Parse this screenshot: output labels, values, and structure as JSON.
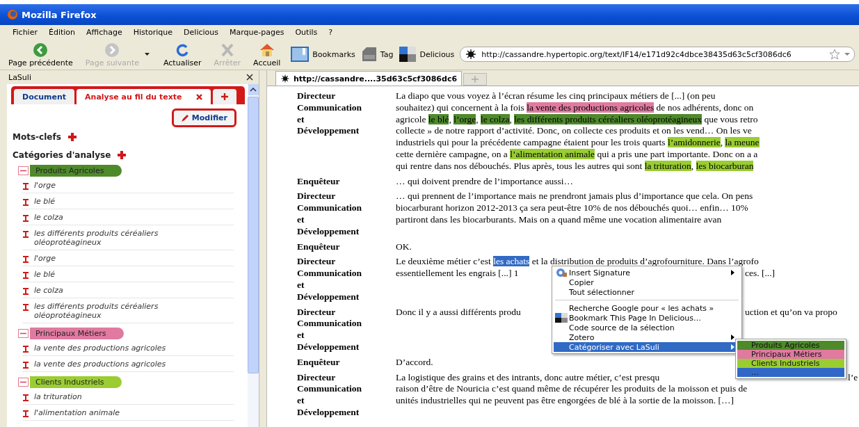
{
  "window": {
    "title": "Mozilla Firefox"
  },
  "menu": [
    "Fichier",
    "Édition",
    "Affichage",
    "Historique",
    "Delicious",
    "Marque-pages",
    "Outils",
    "?"
  ],
  "nav_buttons": [
    {
      "kind": "back",
      "label": "Page précédente",
      "disabled": false
    },
    {
      "kind": "forward",
      "label": "Page suivante",
      "disabled": true
    },
    {
      "kind": "reload",
      "label": "Actualiser",
      "disabled": false
    },
    {
      "kind": "stop",
      "label": "Arrêter",
      "disabled": true
    },
    {
      "kind": "home",
      "label": "Accueil",
      "disabled": false
    }
  ],
  "bookmarks": [
    {
      "kind": "bookmarks",
      "label": "Bookmarks"
    },
    {
      "kind": "tag",
      "label": "Tag"
    },
    {
      "kind": "delicious",
      "label": "Delicious"
    }
  ],
  "address": {
    "value": "http://cassandre.hypertopic.org/text/IF14/e171d92c4dbce38435d63c5cf3086dc6"
  },
  "sidebar": {
    "title": "LaSuli",
    "tabs": [
      {
        "label": "Document",
        "selected": false
      },
      {
        "label": "Analyse au fil du texte",
        "selected": true
      }
    ],
    "edit_button": "Modifier",
    "keywords_heading": "Mots-clefs",
    "categories_heading": "Catégories d'analyse",
    "categories": [
      {
        "name": "Produits Agricoles",
        "color": "#4e8a2a",
        "expanded": true,
        "items": [
          "l'orge",
          "le blé",
          "le colza",
          "les différents produits céréaliers oléoprotéagineux",
          "l'orge",
          "le blé",
          "le colza",
          "les différents produits céréaliers oléoprotéagineux"
        ]
      },
      {
        "name": "Principaux Métiers",
        "color": "#e07aa0",
        "expanded": true,
        "items": [
          "la vente des productions agricoles",
          "la vente des productions agricoles"
        ]
      },
      {
        "name": "Clients Industriels",
        "color": "#9acd32",
        "expanded": true,
        "items": [
          "la trituration",
          "l'alimentation animale"
        ]
      }
    ]
  },
  "browser_tab": {
    "title": "http://cassandre....35d63c5cf3086dc6"
  },
  "transcript": [
    {
      "speaker": "Directeur Communication et Développement",
      "lines": [
        {
          "segments": [
            {
              "kind": "text",
              "text": "La diapo que vous voyez à l’écran résume les cinq principaux métiers de [...] (on peu"
            }
          ]
        },
        {
          "segments": [
            {
              "kind": "text",
              "text": "souhaitez) qui concernent à la fois "
            },
            {
              "kind": "highlight",
              "color": "#e07aa0",
              "text": "la vente des productions agricoles"
            },
            {
              "kind": "text",
              "text": " de nos adhérents, donc on"
            }
          ]
        },
        {
          "segments": [
            {
              "kind": "text",
              "text": "agricole "
            },
            {
              "kind": "highlight",
              "color": "#4e8a2a",
              "text": "le blé"
            },
            {
              "kind": "text",
              "text": ", "
            },
            {
              "kind": "highlight",
              "color": "#4e8a2a",
              "text": "l’orge"
            },
            {
              "kind": "text",
              "text": ", "
            },
            {
              "kind": "highlight",
              "color": "#4e8a2a",
              "text": "le colza"
            },
            {
              "kind": "text",
              "text": ", "
            },
            {
              "kind": "highlight",
              "color": "#4e8a2a",
              "text": "les différents produits céréaliers oléoprotéagineux"
            },
            {
              "kind": "text",
              "text": " que vous retro"
            }
          ]
        },
        {
          "segments": [
            {
              "kind": "text",
              "text": "collecte » de notre rapport d’activité. Donc, on collecte ces produits et on les vend… On les ve"
            }
          ]
        },
        {
          "segments": [
            {
              "kind": "text",
              "text": "industriels qui pour la précédente campagne étaient pour les trois quarts "
            },
            {
              "kind": "highlight",
              "color": "#9acd32",
              "text": "l’amidonnerie"
            },
            {
              "kind": "text",
              "text": ", "
            },
            {
              "kind": "highlight",
              "color": "#9acd32",
              "text": "la meune"
            }
          ]
        },
        {
          "segments": [
            {
              "kind": "text",
              "text": "cette dernière campagne, on a "
            },
            {
              "kind": "highlight",
              "color": "#9acd32",
              "text": "l’alimentation animale"
            },
            {
              "kind": "text",
              "text": " qui a pris une part importante. Donc on a a"
            }
          ]
        },
        {
          "segments": [
            {
              "kind": "text",
              "text": "qui rentre dans nos débouchés. Plus après, tous les autres qui sont "
            },
            {
              "kind": "highlight",
              "color": "#9acd32",
              "text": "la trituration"
            },
            {
              "kind": "text",
              "text": ", "
            },
            {
              "kind": "highlight",
              "color": "#9acd32",
              "text": "les biocarburan"
            }
          ]
        }
      ]
    },
    {
      "speaker": "Enquêteur",
      "lines": [
        {
          "segments": [
            {
              "kind": "text",
              "text": "… qui doivent prendre de l’importance aussi…"
            }
          ]
        }
      ]
    },
    {
      "speaker": "Directeur Communication et Développement",
      "lines": [
        {
          "segments": [
            {
              "kind": "text",
              "text": "… qui prennent de l’importance mais ne prendront jamais plus d’importance que cela. On pens"
            }
          ]
        },
        {
          "segments": [
            {
              "kind": "text",
              "text": "biocarburant horizon 2012-2013 ça sera peut-être 10% de nos débouchés quoi… enfin… 10%"
            }
          ]
        },
        {
          "segments": [
            {
              "kind": "text",
              "text": "partiront dans les biocarburants. Mais on a quand même une vocation alimentaire avan"
            }
          ]
        }
      ]
    },
    {
      "speaker": "Enquêteur",
      "lines": [
        {
          "segments": [
            {
              "kind": "text",
              "text": "OK."
            }
          ]
        }
      ]
    },
    {
      "speaker": "Directeur Communication et Développement",
      "lines": [
        {
          "segments": [
            {
              "kind": "text",
              "text": "Le deuxième métier c’est "
            },
            {
              "kind": "selection",
              "text": "les achats"
            },
            {
              "kind": "text",
              "text": " et la distribution de produits d’agrofourniture. Dans l’agrofo"
            }
          ]
        },
        {
          "segments": [
            {
              "kind": "text",
              "text": "essentiellement les engrais [...] 1"
            }
          ],
          "after_menu": "ces. [...]"
        }
      ]
    },
    {
      "speaker": "Directeur Communication et Développement",
      "lines": [
        {
          "segments": [
            {
              "kind": "text",
              "text": "Donc il y a aussi différents produ"
            }
          ],
          "after_menu": "uction et qu’on va propo"
        }
      ]
    },
    {
      "speaker": "Enquêteur",
      "lines": [
        {
          "segments": [
            {
              "kind": "text",
              "text": "D’accord."
            }
          ]
        }
      ]
    },
    {
      "speaker": "Directeur Communication et Développement",
      "lines": [
        {
          "segments": [
            {
              "kind": "text",
              "text": "La logistique des grains et des intrants, donc autre métier, c’est presqu"
            }
          ],
          "after_submenu": "l’e"
        },
        {
          "segments": [
            {
              "kind": "text",
              "text": "raison d’être de Nouricia c’est quand même de récupérer les produits de la moisson et puis de"
            }
          ]
        },
        {
          "segments": [
            {
              "kind": "text",
              "text": "unités industrielles qui ne peuvent pas être engorgées de blé à la sortie de la moisson. […]"
            }
          ]
        }
      ]
    }
  ],
  "context_menu": {
    "items": [
      {
        "kind": "item",
        "label": "Insert Signature",
        "submenu": true,
        "selected": false
      },
      {
        "kind": "item",
        "label": "Copier",
        "submenu": false,
        "selected": false
      },
      {
        "kind": "item",
        "label": "Tout sélectionner",
        "submenu": false,
        "selected": false
      },
      {
        "kind": "separator"
      },
      {
        "kind": "item",
        "label": "Recherche Google pour « les achats »",
        "submenu": false,
        "selected": false
      },
      {
        "kind": "item",
        "label": "Bookmark This Page In Delicious…",
        "submenu": false,
        "selected": false
      },
      {
        "kind": "item",
        "label": "Code source de la sélection",
        "submenu": false,
        "selected": false
      },
      {
        "kind": "item",
        "label": "Zotero",
        "submenu": true,
        "selected": false
      },
      {
        "kind": "item",
        "label": "Catégoriser avec LaSuli",
        "submenu": true,
        "selected": true
      }
    ],
    "submenu": [
      {
        "label": "Produits Agricoles",
        "color": "#4e8a2a"
      },
      {
        "label": "Principaux Métiers",
        "color": "#e07aa0"
      },
      {
        "label": "Clients Industriels",
        "color": "#9acd32"
      },
      {
        "label": "…",
        "color": "#3168c8"
      }
    ]
  }
}
